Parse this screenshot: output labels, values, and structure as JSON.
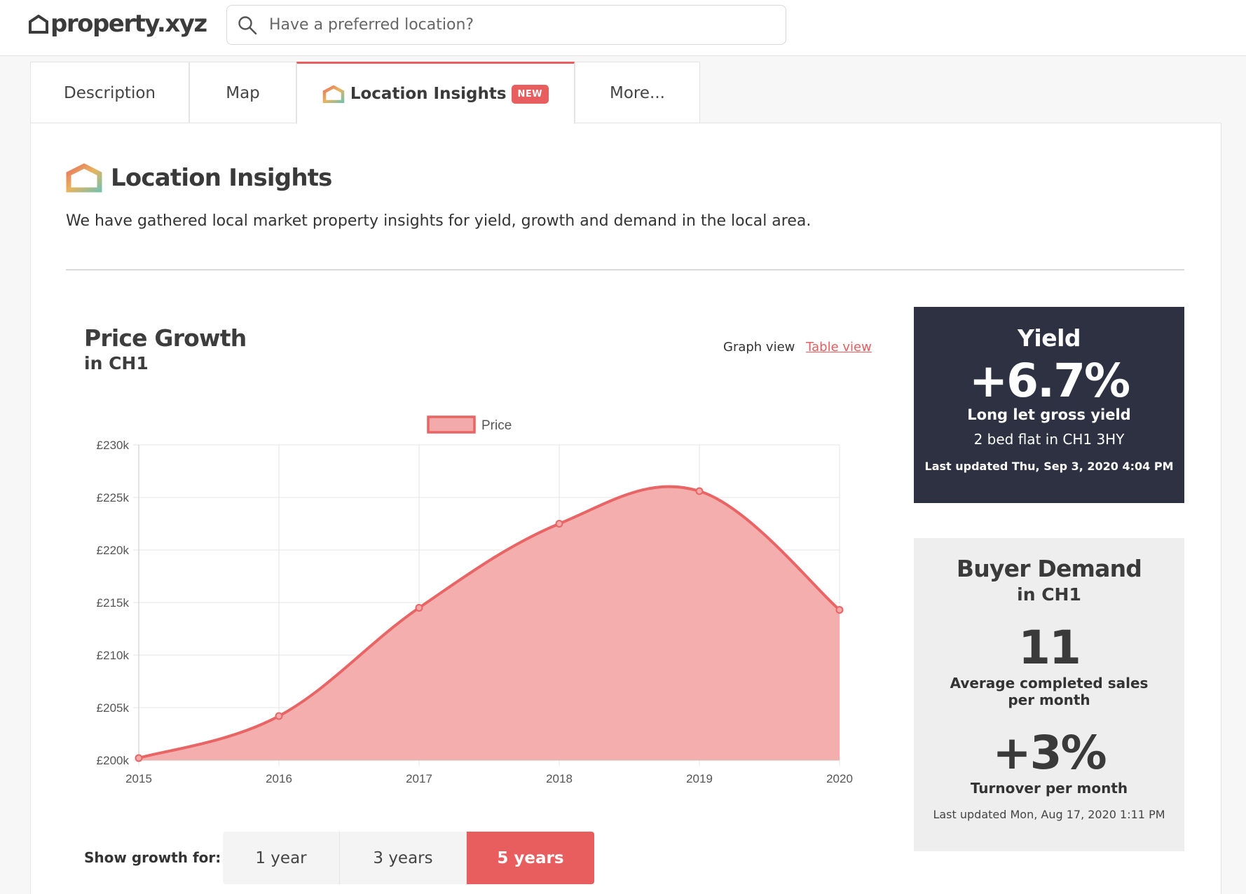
{
  "header": {
    "logo_text": "property.xyz",
    "search_placeholder": "Have a preferred location?"
  },
  "tabs": [
    {
      "label": "Description"
    },
    {
      "label": "Map"
    },
    {
      "label": "Location Insights",
      "badge": "NEW",
      "active": true
    },
    {
      "label": "More..."
    }
  ],
  "section": {
    "title": "Location Insights",
    "intro": "We have gathered local market property insights for yield, growth and demand in the local area."
  },
  "price_growth": {
    "title": "Price Growth",
    "subtitle": "in CH1",
    "graph_view_label": "Graph view",
    "table_view_label": "Table view"
  },
  "chart_data": {
    "type": "area",
    "x": [
      "2015",
      "2016",
      "2017",
      "2018",
      "2019",
      "2020"
    ],
    "series": [
      {
        "name": "Price",
        "values": [
          200200,
          204200,
          214500,
          222500,
          225600,
          214300
        ]
      }
    ],
    "ylim": [
      200000,
      230000
    ],
    "y_ticks": [
      "£200k",
      "£205k",
      "£210k",
      "£215k",
      "£220k",
      "£225k",
      "£230k"
    ],
    "grid": true,
    "legend": "top-center",
    "colors": {
      "line": "#e96464",
      "fill": "#f3aaaa"
    }
  },
  "range_selector": {
    "label": "Show growth for:",
    "options": [
      "1 year",
      "3 years",
      "5 years"
    ],
    "selected": "5 years"
  },
  "yield_card": {
    "title": "Yield",
    "value": "+6.7%",
    "line1": "Long let gross yield",
    "line2": "2 bed flat in CH1 3HY",
    "updated": "Last updated Thu, Sep 3, 2020 4:04 PM"
  },
  "demand_card": {
    "title": "Buyer Demand",
    "subtitle": "in CH1",
    "sales_value": "11",
    "sales_label": "Average completed sales per month",
    "turnover_value": "+3%",
    "turnover_label": "Turnover per month",
    "updated": "Last updated Mon, Aug 17, 2020 1:11 PM"
  },
  "colors": {
    "accent": "#e85d5d",
    "dark_card": "#2d3142",
    "light_card": "#eeeeee"
  }
}
